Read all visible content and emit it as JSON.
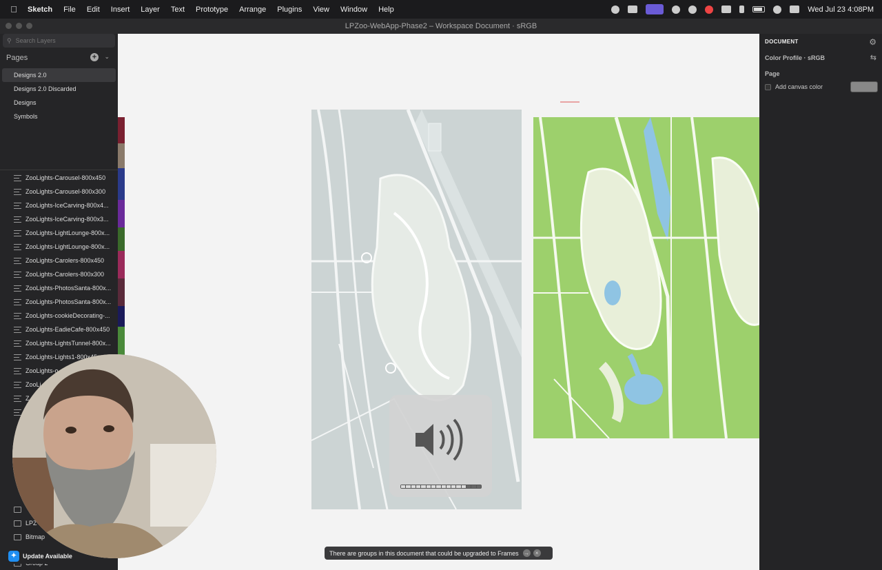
{
  "menubar": {
    "app": "Sketch",
    "items": [
      "File",
      "Edit",
      "Insert",
      "Layer",
      "Text",
      "Prototype",
      "Arrange",
      "Plugins",
      "View",
      "Window",
      "Help"
    ],
    "clock": "Wed Jul 23  4:08PM"
  },
  "window": {
    "title": "LPZoo-WebApp-Phase2 – Workspace Document · sRGB"
  },
  "sidebar": {
    "search_placeholder": "Search Layers",
    "pages_label": "Pages",
    "pages": [
      "Designs 2.0",
      "Designs 2.0 Discarded",
      "Designs",
      "Symbols"
    ],
    "layers": [
      "ZooLights-Carousel-800x450",
      "ZooLights-Carousel-800x300",
      "ZooLights-IceCarving-800x4...",
      "ZooLights-IceCarving-800x3...",
      "ZooLights-LightLounge-800x...",
      "ZooLights-LightLounge-800x...",
      "ZooLights-Carolers-800x450",
      "ZooLights-Carolers-800x300",
      "ZooLights-PhotosSanta-800x...",
      "ZooLights-PhotosSanta-800x...",
      "ZooLights-cookieDecorating-...",
      "ZooLights-EadieCafe-800x450",
      "ZooLights-LightsTunnel-800x...",
      "ZooLights-Lights1-800x45",
      "ZooLights-o",
      "ZooLi",
      "Z",
      "Z"
    ],
    "bottom_layers": [
      "LPZ",
      "Bitmap",
      "Group 2"
    ],
    "update_label": "Update Available"
  },
  "canvas": {
    "toast": "There are groups in this document that could be upgraded to Frames",
    "volume_level": 0.8
  },
  "inspector": {
    "title": "DOCUMENT",
    "color_profile": "Color Profile · sRGB",
    "page_label": "Page",
    "add_canvas_color": "Add canvas color"
  },
  "colors": {
    "map_gray": "#ccd4d4",
    "map_green": "#9dd06c",
    "water": "#8fc4e3",
    "accent": "#6a5bd6"
  }
}
